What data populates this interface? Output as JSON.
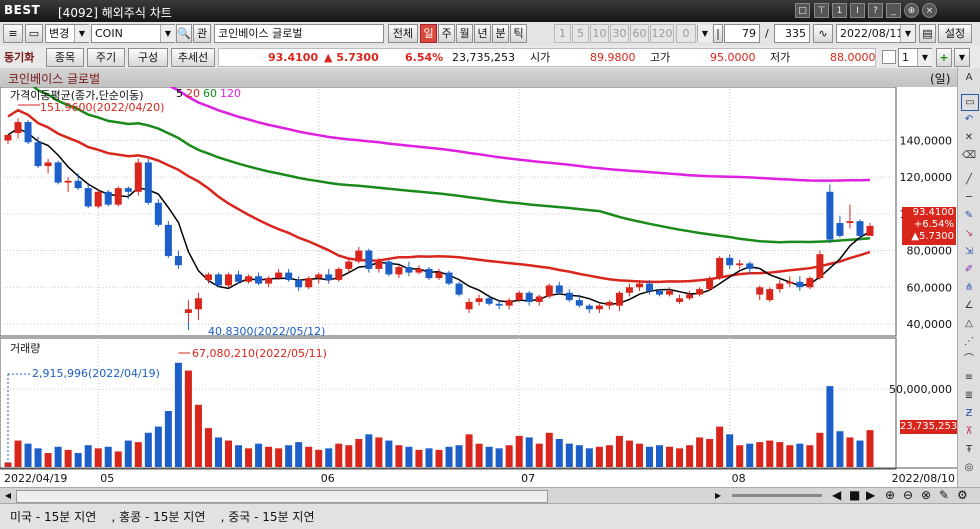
{
  "window": {
    "logo": "BEST",
    "title": "[4092] 해외주식 차트",
    "controls": [
      "□",
      "⊤",
      "1",
      "Ⅰ",
      "?",
      "_",
      "⊕",
      "×"
    ]
  },
  "toolbar": {
    "change_label": "변경",
    "symbol": "COIN",
    "kwan_label": "관",
    "name": "코인베이스 글로벌",
    "all_label": "전체",
    "periods": [
      "일",
      "주",
      "월",
      "년",
      "분",
      "틱"
    ],
    "active_period": "일",
    "counts": [
      "1",
      "5",
      "10",
      "30",
      "60",
      "120",
      "0"
    ],
    "bar_count": "79",
    "slash": "/",
    "total_count": "335",
    "date": "2022/08/11",
    "settings_label": "설정"
  },
  "row2": {
    "sync_label": "동기화",
    "item_label": "종목",
    "cycle_label": "주기",
    "compose_label": "구성",
    "trend_label": "추세선",
    "price": "93.4100",
    "change": "▲ 5.7300",
    "pct": "6.54%",
    "volume": "23,735,253",
    "open_label": "시가",
    "open": "89.9800",
    "high_label": "고가",
    "high": "95.0000",
    "low_label": "저가",
    "low": "88.0000",
    "count_value": "1"
  },
  "chart_header": {
    "name": "코인베이스 글로벌",
    "unit": "(일)"
  },
  "price_panel": {
    "legend_prefix": "가격이동평균(종가,단순이동)",
    "ma_labels": [
      "5",
      "20",
      "60",
      "120"
    ],
    "ma_colors": [
      "#000000",
      "#d8261c",
      "#1a8a1a",
      "#e020e0"
    ],
    "max_annotation": "151.9600(2022/04/20)",
    "min_annotation": "40.8300(2022/05/12)",
    "price_box": [
      "93.4100",
      "+6.54%",
      "▲5.7300"
    ]
  },
  "volume_panel": {
    "title": "거래량",
    "max_annotation": "67,080,210(2022/05/11)",
    "start_annotation": "2,915,996(2022/04/19)",
    "last_box": "23,735,253"
  },
  "colors": {
    "up": "#d8261c",
    "down": "#1c5fc8"
  },
  "status": {
    "markets": "미국 - 15분 지연    , 홍콩 - 15분 지연    , 중국 - 15분 지연"
  },
  "chart_data": {
    "type": "candlestick",
    "x_ticks": [
      "2022/04/19",
      "05",
      "06",
      "07",
      "08",
      "2022/08/10"
    ],
    "y_ticks": [
      "40,0000",
      "60,0000",
      "80,0000",
      "100,0000",
      "120,0000",
      "140,0000"
    ],
    "y_range": [
      34,
      168
    ],
    "volume_ticks": [
      "50,000,000"
    ],
    "volume_range": [
      0,
      72000000
    ],
    "candles": [
      {
        "d": "04/19",
        "o": 140,
        "h": 142,
        "l": 138,
        "c": 143,
        "v": 2.9
      },
      {
        "d": "04/20",
        "o": 144,
        "h": 152,
        "l": 141,
        "c": 150,
        "v": 17
      },
      {
        "d": "04/21",
        "o": 150,
        "h": 151,
        "l": 138,
        "c": 139,
        "v": 15
      },
      {
        "d": "04/22",
        "o": 139,
        "h": 142,
        "l": 125,
        "c": 126,
        "v": 12
      },
      {
        "d": "04/25",
        "o": 126,
        "h": 130,
        "l": 122,
        "c": 128,
        "v": 9
      },
      {
        "d": "04/26",
        "o": 128,
        "h": 129,
        "l": 116,
        "c": 117,
        "v": 13
      },
      {
        "d": "04/27",
        "o": 117,
        "h": 120,
        "l": 112,
        "c": 118,
        "v": 11
      },
      {
        "d": "04/28",
        "o": 118,
        "h": 122,
        "l": 113,
        "c": 114,
        "v": 9
      },
      {
        "d": "04/29",
        "o": 114,
        "h": 116,
        "l": 103,
        "c": 104,
        "v": 14
      },
      {
        "d": "05/02",
        "o": 104,
        "h": 113,
        "l": 103,
        "c": 112,
        "v": 12
      },
      {
        "d": "05/03",
        "o": 112,
        "h": 113,
        "l": 104,
        "c": 105,
        "v": 13
      },
      {
        "d": "05/04",
        "o": 105,
        "h": 115,
        "l": 104,
        "c": 114,
        "v": 10
      },
      {
        "d": "05/05",
        "o": 114,
        "h": 115,
        "l": 108,
        "c": 112,
        "v": 17
      },
      {
        "d": "05/06",
        "o": 112,
        "h": 130,
        "l": 110,
        "c": 128,
        "v": 16
      },
      {
        "d": "05/09",
        "o": 128,
        "h": 130,
        "l": 105,
        "c": 106,
        "v": 22
      },
      {
        "d": "05/10",
        "o": 106,
        "h": 108,
        "l": 93,
        "c": 94,
        "v": 26
      },
      {
        "d": "05/11",
        "o": 94,
        "h": 96,
        "l": 76,
        "c": 77,
        "v": 36
      },
      {
        "d": "05/12",
        "o": 77,
        "h": 80,
        "l": 70,
        "c": 72,
        "v": 67
      },
      {
        "d": "05/13",
        "o": 46,
        "h": 53,
        "l": 41,
        "c": 48,
        "v": 62
      },
      {
        "d": "05/16",
        "o": 48,
        "h": 57,
        "l": 42,
        "c": 54,
        "v": 40
      },
      {
        "d": "05/17",
        "o": 64,
        "h": 68,
        "l": 62,
        "c": 67,
        "v": 25
      },
      {
        "d": "05/18",
        "o": 67,
        "h": 68,
        "l": 60,
        "c": 61,
        "v": 19
      },
      {
        "d": "05/19",
        "o": 61,
        "h": 68,
        "l": 60,
        "c": 67,
        "v": 17
      },
      {
        "d": "05/20",
        "o": 67,
        "h": 69,
        "l": 62,
        "c": 63,
        "v": 14
      },
      {
        "d": "05/23",
        "o": 63,
        "h": 67,
        "l": 62,
        "c": 66,
        "v": 12
      },
      {
        "d": "05/24",
        "o": 66,
        "h": 68,
        "l": 61,
        "c": 62,
        "v": 15
      },
      {
        "d": "05/25",
        "o": 62,
        "h": 66,
        "l": 60,
        "c": 65,
        "v": 13
      },
      {
        "d": "05/26",
        "o": 65,
        "h": 70,
        "l": 64,
        "c": 68,
        "v": 12
      },
      {
        "d": "05/27",
        "o": 68,
        "h": 70,
        "l": 63,
        "c": 64,
        "v": 14
      },
      {
        "d": "05/31",
        "o": 64,
        "h": 66,
        "l": 58,
        "c": 60,
        "v": 16
      },
      {
        "d": "06/01",
        "o": 60,
        "h": 66,
        "l": 59,
        "c": 65,
        "v": 13
      },
      {
        "d": "06/02",
        "o": 65,
        "h": 68,
        "l": 62,
        "c": 67,
        "v": 11
      },
      {
        "d": "06/03",
        "o": 67,
        "h": 70,
        "l": 62,
        "c": 64,
        "v": 12
      },
      {
        "d": "06/06",
        "o": 64,
        "h": 71,
        "l": 63,
        "c": 70,
        "v": 15
      },
      {
        "d": "06/07",
        "o": 70,
        "h": 75,
        "l": 68,
        "c": 74,
        "v": 14
      },
      {
        "d": "06/08",
        "o": 74,
        "h": 82,
        "l": 73,
        "c": 80,
        "v": 18
      },
      {
        "d": "06/09",
        "o": 80,
        "h": 81,
        "l": 68,
        "c": 70,
        "v": 21
      },
      {
        "d": "06/10",
        "o": 70,
        "h": 76,
        "l": 68,
        "c": 74,
        "v": 19
      },
      {
        "d": "06/13",
        "o": 74,
        "h": 75,
        "l": 66,
        "c": 67,
        "v": 17
      },
      {
        "d": "06/14",
        "o": 67,
        "h": 72,
        "l": 65,
        "c": 71,
        "v": 14
      },
      {
        "d": "06/15",
        "o": 71,
        "h": 74,
        "l": 66,
        "c": 68,
        "v": 13
      },
      {
        "d": "06/16",
        "o": 68,
        "h": 72,
        "l": 67,
        "c": 70,
        "v": 11
      },
      {
        "d": "06/17",
        "o": 70,
        "h": 71,
        "l": 64,
        "c": 65,
        "v": 12
      },
      {
        "d": "06/21",
        "o": 65,
        "h": 70,
        "l": 64,
        "c": 68,
        "v": 11
      },
      {
        "d": "06/22",
        "o": 68,
        "h": 69,
        "l": 61,
        "c": 62,
        "v": 13
      },
      {
        "d": "06/23",
        "o": 62,
        "h": 63,
        "l": 55,
        "c": 56,
        "v": 14
      },
      {
        "d": "06/24",
        "o": 48,
        "h": 54,
        "l": 46,
        "c": 52,
        "v": 21
      },
      {
        "d": "06/27",
        "o": 52,
        "h": 56,
        "l": 50,
        "c": 54,
        "v": 15
      },
      {
        "d": "06/28",
        "o": 54,
        "h": 56,
        "l": 50,
        "c": 51,
        "v": 13
      },
      {
        "d": "06/29",
        "o": 51,
        "h": 53,
        "l": 48,
        "c": 50,
        "v": 12
      },
      {
        "d": "06/30",
        "o": 50,
        "h": 54,
        "l": 48,
        "c": 53,
        "v": 14
      },
      {
        "d": "07/01",
        "o": 53,
        "h": 58,
        "l": 52,
        "c": 57,
        "v": 20
      },
      {
        "d": "07/05",
        "o": 57,
        "h": 58,
        "l": 50,
        "c": 52,
        "v": 19
      },
      {
        "d": "07/06",
        "o": 52,
        "h": 56,
        "l": 50,
        "c": 55,
        "v": 15
      },
      {
        "d": "07/07",
        "o": 55,
        "h": 62,
        "l": 54,
        "c": 61,
        "v": 22
      },
      {
        "d": "07/08",
        "o": 61,
        "h": 63,
        "l": 56,
        "c": 57,
        "v": 18
      },
      {
        "d": "07/11",
        "o": 57,
        "h": 59,
        "l": 52,
        "c": 53,
        "v": 15
      },
      {
        "d": "07/12",
        "o": 53,
        "h": 56,
        "l": 49,
        "c": 50,
        "v": 14
      },
      {
        "d": "07/13",
        "o": 50,
        "h": 51,
        "l": 46,
        "c": 48,
        "v": 12
      },
      {
        "d": "07/14",
        "o": 48,
        "h": 51,
        "l": 46,
        "c": 50,
        "v": 13
      },
      {
        "d": "07/15",
        "o": 50,
        "h": 53,
        "l": 48,
        "c": 52,
        "v": 14
      },
      {
        "d": "07/18",
        "o": 50,
        "h": 58,
        "l": 47,
        "c": 57,
        "v": 20
      },
      {
        "d": "07/19",
        "o": 57,
        "h": 62,
        "l": 55,
        "c": 60,
        "v": 17
      },
      {
        "d": "07/20",
        "o": 60,
        "h": 64,
        "l": 58,
        "c": 62,
        "v": 15
      },
      {
        "d": "07/21",
        "o": 62,
        "h": 64,
        "l": 56,
        "c": 58,
        "v": 13
      },
      {
        "d": "07/22",
        "o": 58,
        "h": 59,
        "l": 55,
        "c": 56,
        "v": 14
      },
      {
        "d": "07/25",
        "o": 56,
        "h": 60,
        "l": 55,
        "c": 58,
        "v": 13
      },
      {
        "d": "07/26",
        "o": 52,
        "h": 56,
        "l": 51,
        "c": 54,
        "v": 12
      },
      {
        "d": "07/27",
        "o": 54,
        "h": 58,
        "l": 53,
        "c": 56,
        "v": 14
      },
      {
        "d": "07/28",
        "o": 56,
        "h": 60,
        "l": 55,
        "c": 59,
        "v": 19
      },
      {
        "d": "07/29",
        "o": 59,
        "h": 66,
        "l": 58,
        "c": 65,
        "v": 18
      },
      {
        "d": "08/01",
        "o": 65,
        "h": 77,
        "l": 64,
        "c": 76,
        "v": 26
      },
      {
        "d": "08/02",
        "o": 76,
        "h": 78,
        "l": 70,
        "c": 72,
        "v": 21
      },
      {
        "d": "08/03",
        "o": 72,
        "h": 75,
        "l": 70,
        "c": 73,
        "v": 14
      },
      {
        "d": "08/04",
        "o": 73,
        "h": 74,
        "l": 67,
        "c": 70,
        "v": 15
      },
      {
        "d": "08/05",
        "o": 56,
        "h": 61,
        "l": 53,
        "c": 60,
        "v": 16
      },
      {
        "d": "08/08",
        "o": 53,
        "h": 60,
        "l": 52,
        "c": 59,
        "v": 17
      },
      {
        "d": "08/09",
        "o": 59,
        "h": 64,
        "l": 57,
        "c": 62,
        "v": 16
      },
      {
        "d": "08/10",
        "o": 62,
        "h": 66,
        "l": 60,
        "c": 63,
        "v": 14
      },
      {
        "d": "08/11",
        "o": 63,
        "h": 66,
        "l": 58,
        "c": 60,
        "v": 15
      },
      {
        "d": "08/12",
        "o": 60,
        "h": 66,
        "l": 59,
        "c": 65,
        "v": 14
      },
      {
        "d": "08/15",
        "o": 65,
        "h": 80,
        "l": 64,
        "c": 78,
        "v": 22
      },
      {
        "d": "08/16",
        "o": 112,
        "h": 116,
        "l": 84,
        "c": 86,
        "v": 52
      },
      {
        "d": "08/17",
        "o": 95,
        "h": 99,
        "l": 87,
        "c": 88,
        "v": 23
      },
      {
        "d": "08/18",
        "o": 95,
        "h": 105,
        "l": 92,
        "c": 96,
        "v": 19
      },
      {
        "d": "08/19",
        "o": 96,
        "h": 97,
        "l": 86,
        "c": 88,
        "v": 17
      },
      {
        "d": "08/22",
        "o": 88,
        "h": 95,
        "l": 88,
        "c": 93.41,
        "v": 23.7
      }
    ]
  }
}
